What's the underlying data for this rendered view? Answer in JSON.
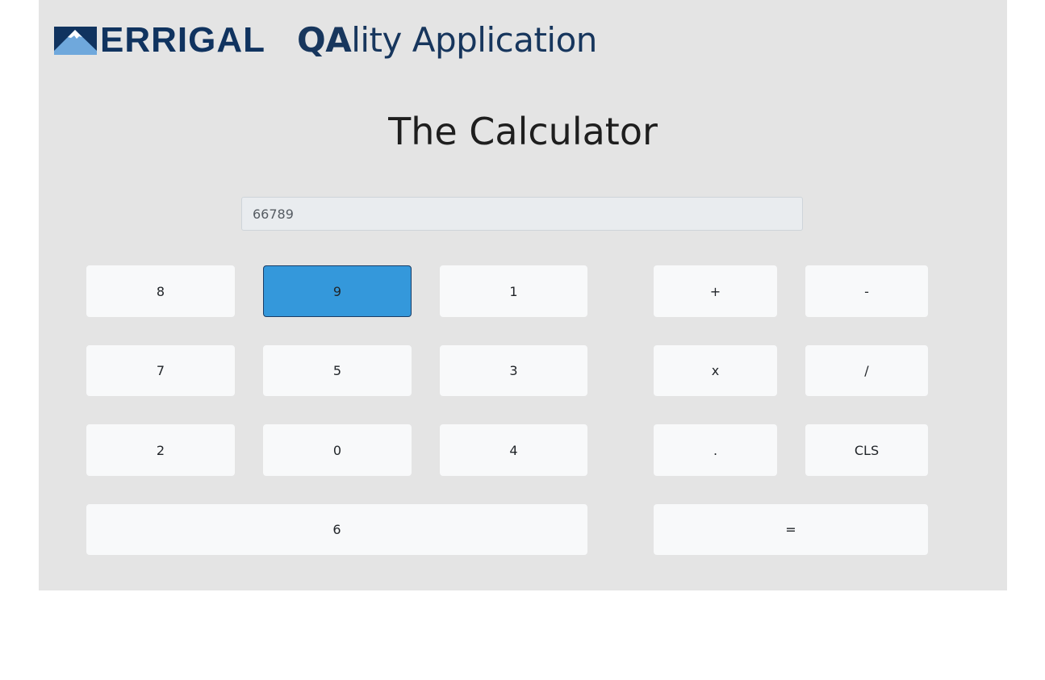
{
  "header": {
    "logo_text": "ERRIGAL",
    "app_title_bold": "QA",
    "app_title_rest": "lity Application"
  },
  "page_title": "The Calculator",
  "display": {
    "value": "66789"
  },
  "keys": {
    "k8": "8",
    "k9": "9",
    "k1": "1",
    "k7": "7",
    "k5": "5",
    "k3": "3",
    "k2": "2",
    "k0": "0",
    "k4": "4",
    "k6": "6",
    "plus": "+",
    "minus": "-",
    "multiply": "x",
    "divide": "/",
    "decimal": ".",
    "clear": "CLS",
    "equals": "="
  },
  "colors": {
    "panel_bg": "#e4e4e4",
    "brand_navy": "#10335f",
    "button_bg": "#f8f9fa",
    "active_button": "#3498db"
  },
  "icons": {
    "logo": "mountain-logo-icon"
  }
}
